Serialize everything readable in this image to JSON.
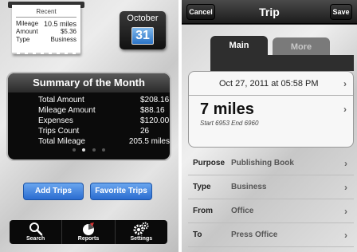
{
  "left": {
    "receipt": {
      "title": "Recent",
      "rows": [
        {
          "label": "Mileage",
          "value": "10.5 miles"
        },
        {
          "label": "Amount",
          "value": "$5.36"
        },
        {
          "label": "Type",
          "value": "Business"
        }
      ]
    },
    "calendar": {
      "month": "October",
      "day": "31"
    },
    "summary": {
      "title": "Summary of the Month",
      "rows": [
        {
          "label": "Total Amount",
          "value": "$208.16"
        },
        {
          "label": "Mileage Amount",
          "value": "$88.16"
        },
        {
          "label": "Expenses",
          "value": "$120.00"
        },
        {
          "label": "Trips Count",
          "value": "26"
        },
        {
          "label": "Total Mileage",
          "value": "205.5 miles"
        }
      ],
      "page_count": 4,
      "active_page": 2
    },
    "buttons": {
      "add_trips": "Add Trips",
      "favorite_trips": "Favorite Trips"
    },
    "tabbar": [
      {
        "label": "Search",
        "icon": "magnifier-icon"
      },
      {
        "label": "Reports",
        "icon": "pie-chart-icon"
      },
      {
        "label": "Settings",
        "icon": "gears-icon"
      }
    ]
  },
  "right": {
    "navbar": {
      "title": "Trip",
      "cancel": "Cancel",
      "save": "Save"
    },
    "segments": {
      "main": "Main",
      "more": "More"
    },
    "trip": {
      "date": "Oct 27, 2011 at 05:58 PM",
      "miles": "7 miles",
      "odometer": "Start 6953   End 6960"
    },
    "fields": [
      {
        "label": "Purpose",
        "value": "Publishing Book"
      },
      {
        "label": "Type",
        "value": "Business"
      },
      {
        "label": "From",
        "value": "Office"
      },
      {
        "label": "To",
        "value": "Press Office"
      }
    ],
    "colors": {
      "accent_blue": "#2a6cd0",
      "nav_dark": "#1c1c1c"
    }
  }
}
